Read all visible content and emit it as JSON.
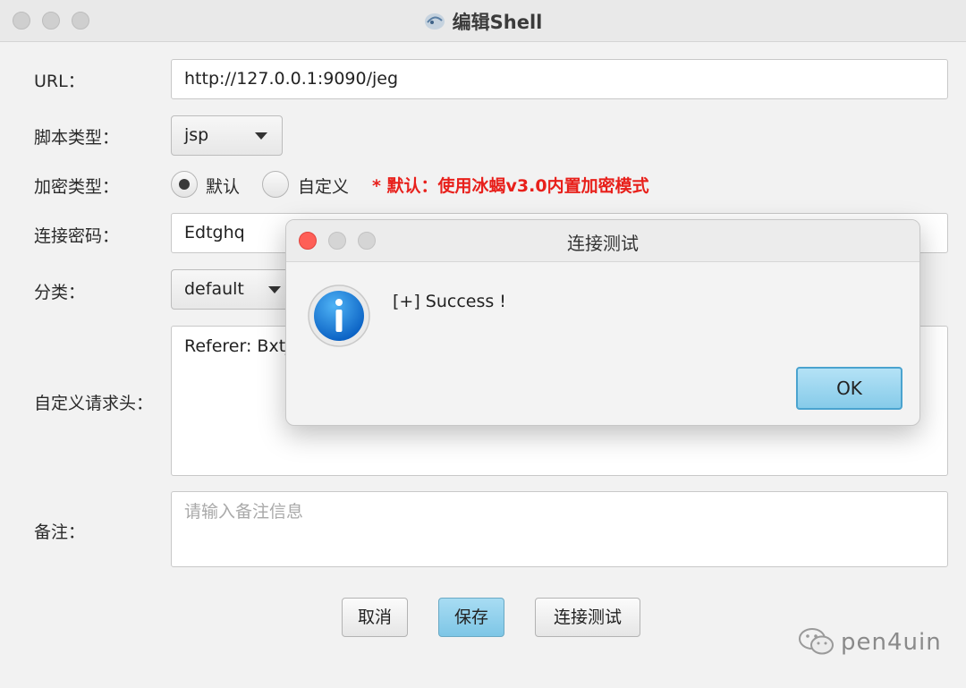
{
  "window": {
    "title": "编辑Shell"
  },
  "form": {
    "url_label": "URL：",
    "url_value": "http://127.0.0.1:9090/jeg",
    "script_type_label": "脚本类型：",
    "script_type_value": "jsp",
    "encryption_label": "加密类型：",
    "encryption_options": [
      "默认",
      "自定义"
    ],
    "encryption_selected": "默认",
    "encryption_note": "* 默认：使用冰蝎v3.0内置加密模式",
    "password_label": "连接密码：",
    "password_value": "Edtghq",
    "category_label": "分类：",
    "category_value": "default",
    "headers_label": "自定义请求头：",
    "headers_value": "Referer: Bxtj",
    "remark_label": "备注：",
    "remark_placeholder": "请输入备注信息"
  },
  "buttons": {
    "cancel": "取消",
    "save": "保存",
    "test": "连接测试"
  },
  "dialog": {
    "title": "连接测试",
    "message": "[+] Success !",
    "ok": "OK",
    "icon": "info-icon"
  },
  "watermark": {
    "text": "pen4uin",
    "icon": "wechat-icon"
  },
  "colors": {
    "note_red": "#e8201b",
    "primary_button": "#8ccbe8",
    "close_red": "#fe5f57"
  }
}
